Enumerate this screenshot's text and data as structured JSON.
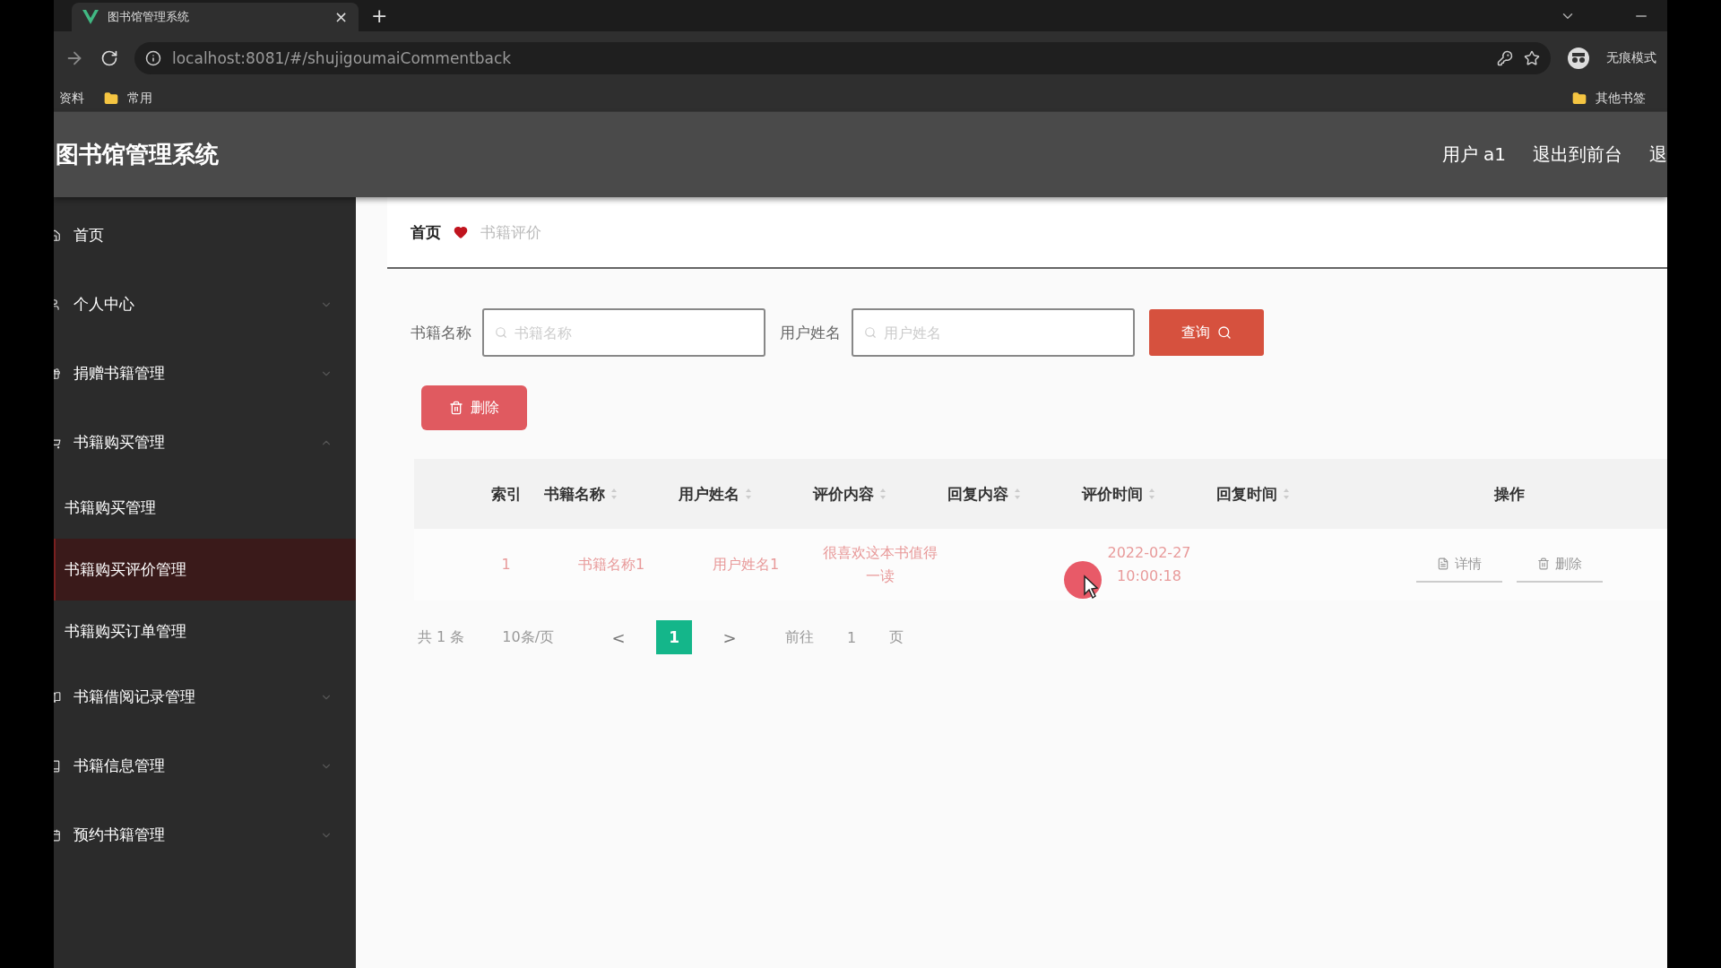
{
  "browser": {
    "tab": {
      "title": "图书馆管理系统",
      "close": "×"
    },
    "new_tab": "+",
    "url": "localhost:8081/#/shujigoumaiCommentback",
    "incognito": "无痕模式",
    "bookmarks": [
      {
        "label": "资料",
        "kind": "text"
      },
      {
        "label": "常用",
        "kind": "folder"
      }
    ],
    "other_bookmarks": "其他书签"
  },
  "header": {
    "title": "图书馆管理系统",
    "links": [
      "用户 a1",
      "退出到前台",
      "退"
    ]
  },
  "sidebar": {
    "items": [
      {
        "label": "首页",
        "selected": false
      },
      {
        "label": "个人中心",
        "expanded": false,
        "selected": false
      },
      {
        "label": "捐赠书籍管理",
        "expanded": false,
        "selected": false
      },
      {
        "label": "书籍购买管理",
        "expanded": true,
        "selected": false,
        "children": [
          {
            "label": "书籍购买管理",
            "selected": false
          },
          {
            "label": "书籍购买评价管理",
            "selected": true
          },
          {
            "label": "书籍购买订单管理",
            "selected": false
          }
        ]
      },
      {
        "label": "书籍借阅记录管理",
        "expanded": false,
        "selected": false
      },
      {
        "label": "书籍信息管理",
        "expanded": false,
        "selected": false
      },
      {
        "label": "预约书籍管理",
        "expanded": false,
        "selected": false
      }
    ]
  },
  "breadcrumb": [
    "首页",
    "书籍评价"
  ],
  "search": {
    "fields": [
      {
        "label": "书籍名称",
        "placeholder": "书籍名称"
      },
      {
        "label": "用户姓名",
        "placeholder": "用户姓名"
      }
    ],
    "button": "查询"
  },
  "delete_button": "删除",
  "table": {
    "columns": [
      "索引",
      "书籍名称",
      "用户姓名",
      "评价内容",
      "回复内容",
      "评价时间",
      "回复时间",
      "操作"
    ],
    "rows": [
      {
        "cells": [
          "1",
          "书籍名称1",
          "用户姓名1",
          "很喜欢这本书值得一读",
          "",
          "2022-02-27 10:00:18",
          ""
        ],
        "actions": [
          "详情",
          "删除"
        ]
      }
    ]
  },
  "pagination": {
    "total": "共 1 条",
    "page_size": "10条/页",
    "prev": "<",
    "pages": [
      {
        "label": "1",
        "selected": true
      }
    ],
    "next": ">",
    "goto": "前往",
    "goto_value": "1",
    "unit": "页"
  }
}
